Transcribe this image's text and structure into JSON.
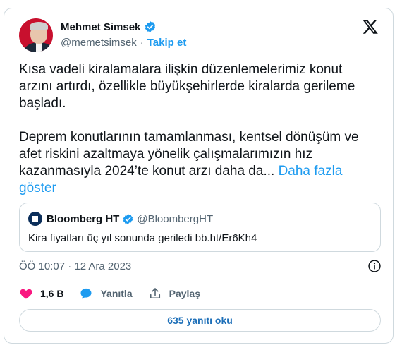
{
  "author": {
    "name": "Mehmet Simsek",
    "handle": "@memetsimsek",
    "separator": "·",
    "follow_label": "Takip et"
  },
  "tweet": {
    "paragraph1": "Kısa vadeli kiralamalara ilişkin düzenlemelerimiz konut arzını artırdı, özellikle büyükşehirlerde kiralarda gerileme başladı.",
    "paragraph2": "Deprem konutlarının tamamlanması, kentsel dönüşüm ve afet riskini azaltmaya yönelik çalışmalarımızın hız kazanmasıyla 2024’te konut arzı daha da...",
    "show_more": "Daha fazla göster"
  },
  "quote": {
    "name": "Bloomberg HT",
    "handle": "@BloombergHT",
    "text": "Kira fiyatları üç yıl sonunda geriledi bb.ht/Er6Kh4"
  },
  "meta": {
    "timestamp": "ÖÖ 10:07 · 12 Ara 2023"
  },
  "actions": {
    "likes": "1,6 B",
    "reply_label": "Yanıtla",
    "share_label": "Paylaş"
  },
  "replies_button": "635 yanıtı oku",
  "colors": {
    "accent": "#1d9bf0",
    "like": "#f91880",
    "verified": "#1d9bf0",
    "border": "#cfd9de",
    "muted": "#536471"
  },
  "icons": [
    "verified-badge-icon",
    "x-logo-icon",
    "info-icon",
    "heart-icon",
    "reply-icon",
    "share-icon"
  ]
}
